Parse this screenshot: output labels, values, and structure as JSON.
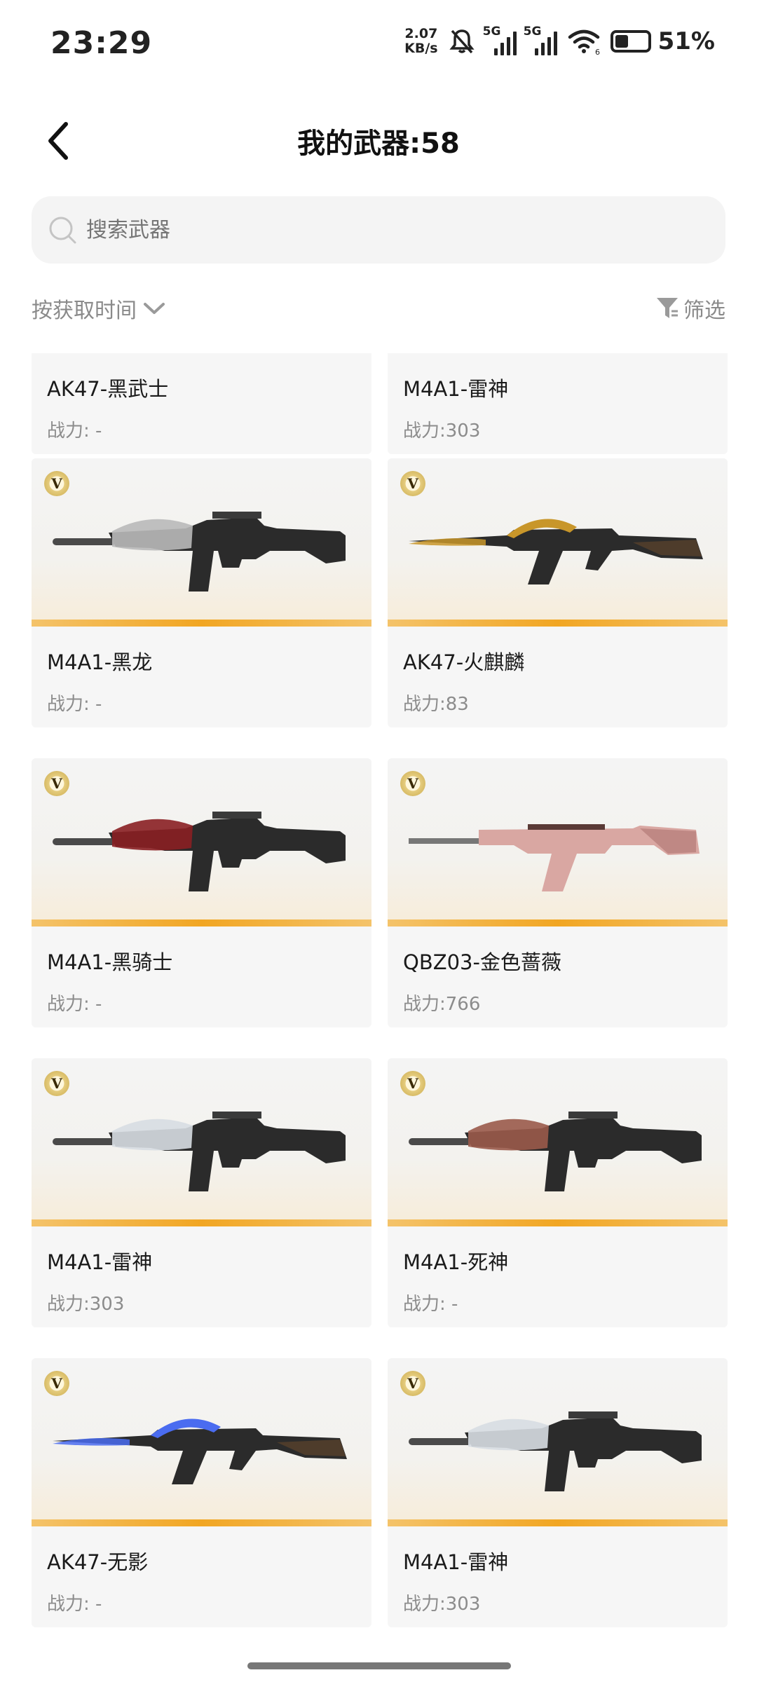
{
  "status_bar": {
    "time": "23:29",
    "net_speed_value": "2.07",
    "net_speed_unit": "KB/s",
    "sim1": "5G",
    "sim2": "5G",
    "wifi_sub": "6",
    "battery": "51%",
    "icons": [
      "mute-bell-icon",
      "signal-icon",
      "wifi-icon",
      "battery-icon"
    ]
  },
  "header": {
    "title": "我的武器:58",
    "back_icon": "chevron-left-icon"
  },
  "search": {
    "placeholder": "搜索武器"
  },
  "toolbar": {
    "sort_label": "按获取时间",
    "filter_label": "筛选"
  },
  "weapons": [
    {
      "name": "AK47-黑武士",
      "power": "战力: -",
      "type": "ak",
      "accent": "#333333"
    },
    {
      "name": "M4A1-雷神",
      "power": "战力:303",
      "type": "m4",
      "accent": "#cccccc"
    },
    {
      "name": "M4A1-黑龙",
      "power": "战力: -",
      "type": "m4",
      "accent": "#b9b9b9"
    },
    {
      "name": "AK47-火麒麟",
      "power": "战力:83",
      "type": "ak",
      "accent": "#c8962a"
    },
    {
      "name": "M4A1-黑骑士",
      "power": "战力: -",
      "type": "m4",
      "accent": "#8a1f22"
    },
    {
      "name": "QBZ03-金色蔷薇",
      "power": "战力:766",
      "type": "qbz",
      "accent": "#d9a7a2"
    },
    {
      "name": "M4A1-雷神",
      "power": "战力:303",
      "type": "m4",
      "accent": "#d7dde2"
    },
    {
      "name": "M4A1-死神",
      "power": "战力: -",
      "type": "m4",
      "accent": "#9a5a4a"
    },
    {
      "name": "AK47-无影",
      "power": "战力: -",
      "type": "ak",
      "accent": "#4a6cf0"
    },
    {
      "name": "M4A1-雷神",
      "power": "战力:303",
      "type": "m4",
      "accent": "#d7dde2"
    }
  ]
}
